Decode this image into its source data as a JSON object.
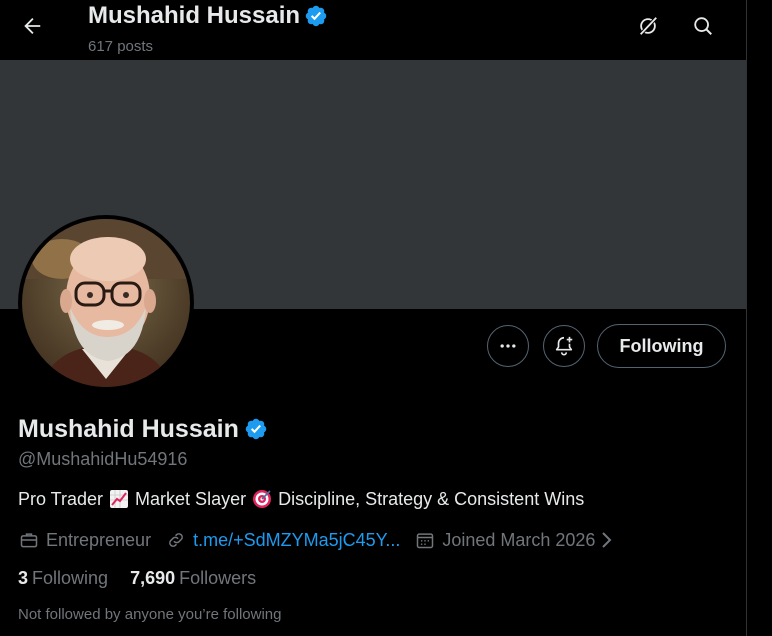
{
  "header": {
    "title": "Mushahid Hussain",
    "posts_count": "617 posts"
  },
  "profile": {
    "name": "Mushahid Hussain",
    "handle": "@MushahidHu54916",
    "bio": {
      "part1": "Pro Trader",
      "emoji1": "chart-increasing",
      "part2": "Market Slayer",
      "emoji2": "direct-hit",
      "part3": "Discipline, Strategy & Consistent Wins"
    },
    "profession": "Entrepreneur",
    "link": "t.me/+SdMZYMa5jC45Y...",
    "joined": "Joined March 2026",
    "following_count": "3",
    "following_label": "Following",
    "followers_count": "7,690",
    "followers_label": "Followers",
    "not_followed": "Not followed by anyone you’re following"
  },
  "actions": {
    "more_icon": "more-icon",
    "notify_icon": "bell-plus-icon",
    "follow_label": "Following"
  },
  "colors": {
    "background": "#000000",
    "banner": "#333639",
    "text": "#e7e9ea",
    "muted": "#71767b",
    "link": "#1d9bf0",
    "verified": "#1d9bf0"
  }
}
